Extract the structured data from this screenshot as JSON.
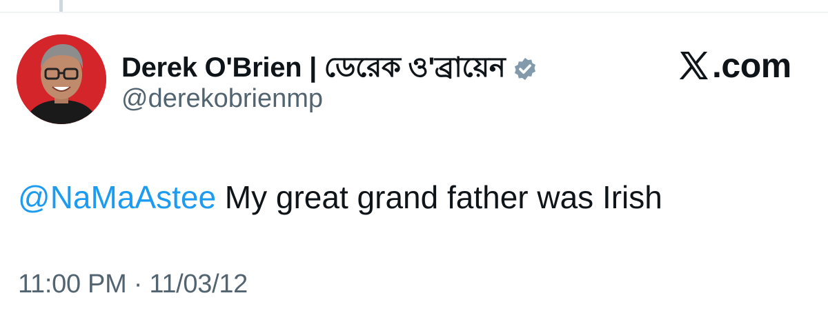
{
  "author": {
    "display_name": "Derek O'Brien | ডেরেক ও'ব্রায়েন",
    "handle": "@derekobrienmp",
    "verified_icon": "verified-badge-icon",
    "avatar_icon": "profile-photo"
  },
  "brand": {
    "logo_icon": "x-logo-icon",
    "text": ".com"
  },
  "tweet": {
    "mention": "@NaMaAstee",
    "body": " My great grand father was Irish"
  },
  "meta": {
    "time": "11:00 PM",
    "separator": " · ",
    "date": "11/03/12"
  },
  "colors": {
    "link": "#1d9bf0",
    "text": "#0f1419",
    "muted": "#536471",
    "avatar_bg": "#d3252a"
  }
}
